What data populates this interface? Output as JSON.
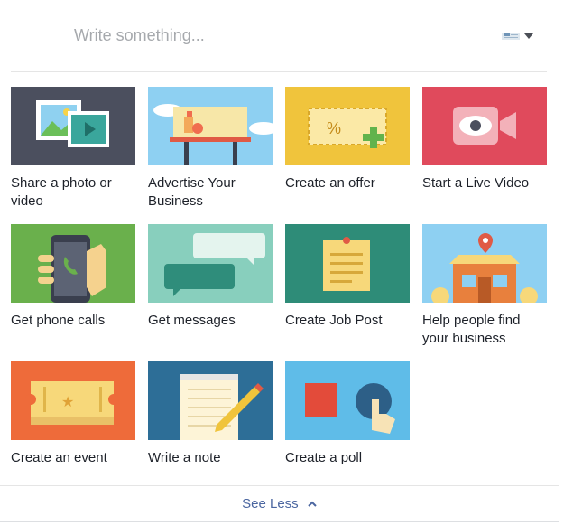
{
  "composer": {
    "placeholder": "Write something...",
    "audience_icon": "page-flag-icon"
  },
  "tiles": [
    {
      "label": "Share a photo or video",
      "icon": "photo-video-icon"
    },
    {
      "label": "Advertise Your Business",
      "icon": "billboard-icon"
    },
    {
      "label": "Create an offer",
      "icon": "offer-coupon-icon"
    },
    {
      "label": "Start a Live Video",
      "icon": "live-video-icon"
    },
    {
      "label": "Get phone calls",
      "icon": "phone-call-icon"
    },
    {
      "label": "Get messages",
      "icon": "messages-icon"
    },
    {
      "label": "Create Job Post",
      "icon": "job-post-icon"
    },
    {
      "label": "Help people find your business",
      "icon": "store-location-icon"
    },
    {
      "label": "Create an event",
      "icon": "event-ticket-icon"
    },
    {
      "label": "Write a note",
      "icon": "note-pencil-icon"
    },
    {
      "label": "Create a poll",
      "icon": "poll-icon"
    }
  ],
  "footer": {
    "see_less_label": "See Less",
    "icon": "chevron-up-icon"
  },
  "colors": {
    "link": "#4b66a0",
    "text": "#1d2129",
    "placeholder": "#a6a9ad"
  }
}
